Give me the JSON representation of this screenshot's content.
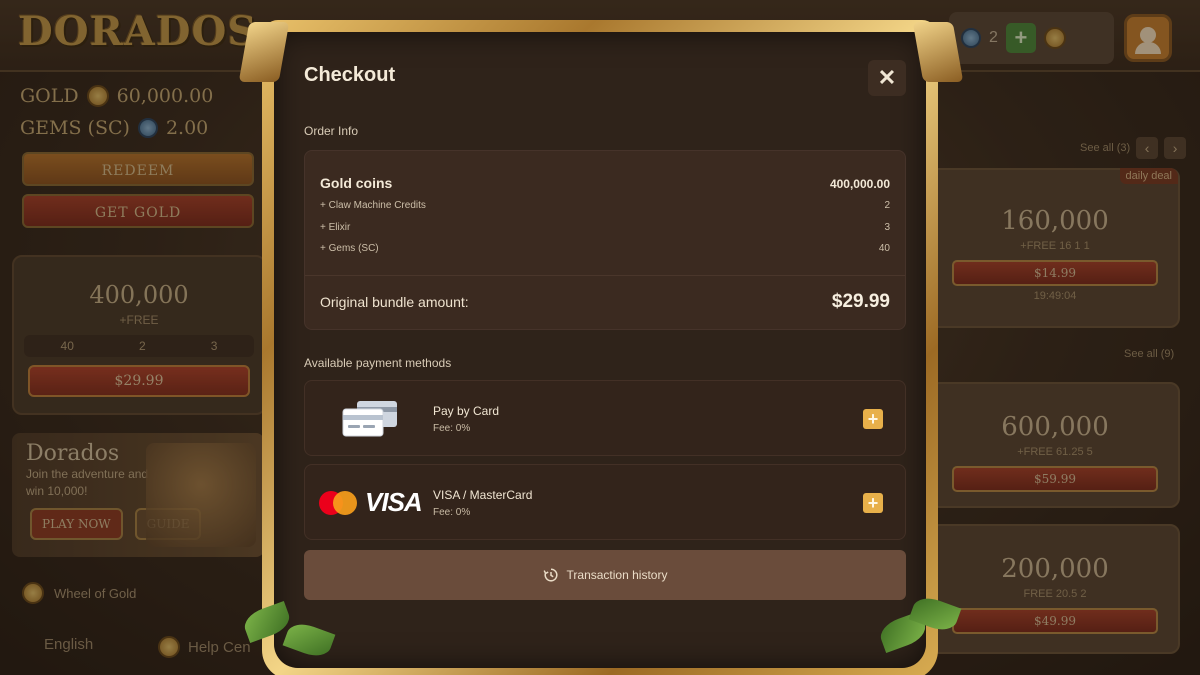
{
  "background": {
    "logo": "DORADOS",
    "balances": {
      "gold_label": "GOLD",
      "gold_value": "60,000.00",
      "gems_label": "GEMS (SC)",
      "gems_value": "2.00"
    },
    "topbar": {
      "gem_count": "2"
    },
    "buttons": {
      "redeem": "REDEEM",
      "get_gold": "GET GOLD"
    },
    "left_offer": {
      "amount": "400,000",
      "free": "+FREE",
      "gems": "40",
      "elixir_a": "2",
      "elixir_b": "3",
      "price": "$29.99"
    },
    "promo": {
      "title": "Dorados",
      "subtitle": "Join the adventure and win",
      "subtitle_amount": "10,000!",
      "play_now": "PLAY NOW",
      "guide": "GUIDE"
    },
    "sidebar": {
      "wheel": "Wheel of Gold",
      "language": "English",
      "help": "Help Cen"
    },
    "right": {
      "see_all_1": "See all (3)",
      "see_all_2": "See all (9)",
      "daily_deal": "daily deal",
      "offer1": {
        "amount": "160,000",
        "free": "+FREE",
        "gems": "16",
        "a": "1",
        "b": "1",
        "price": "$14.99",
        "timer": "19:49:04"
      },
      "offer2": {
        "amount": "600,000",
        "free": "+FREE",
        "gems": "61.25",
        "b": "5",
        "price": "$59.99"
      },
      "offer3": {
        "amount": "200,000",
        "free": "FREE",
        "gems": "20.5",
        "b": "2",
        "price": "$49.99"
      }
    }
  },
  "modal": {
    "title": "Checkout",
    "close_icon": "close-icon",
    "order_info_label": "Order Info",
    "order": {
      "main_item": "Gold coins",
      "main_value": "400,000.00",
      "lines": [
        {
          "label": "+ Claw Machine Credits",
          "value": "2"
        },
        {
          "label": "+ Elixir",
          "value": "3"
        },
        {
          "label": "+ Gems (SC)",
          "value": "40"
        }
      ],
      "total_label": "Original bundle amount:",
      "total_value": "$29.99"
    },
    "payment_label": "Available payment methods",
    "methods": [
      {
        "name": "Pay by Card",
        "fee": "Fee: 0%",
        "icon": "credit-cards-icon"
      },
      {
        "name": "VISA / MasterCard",
        "fee": "Fee: 0%",
        "icon": "visa-mastercard-icon",
        "logo_text": "VISA"
      }
    ],
    "history_label": "Transaction history",
    "colors": {
      "accent": "#e8b04a",
      "panel": "#3b2a20",
      "history_button": "#6a4c3b"
    }
  }
}
